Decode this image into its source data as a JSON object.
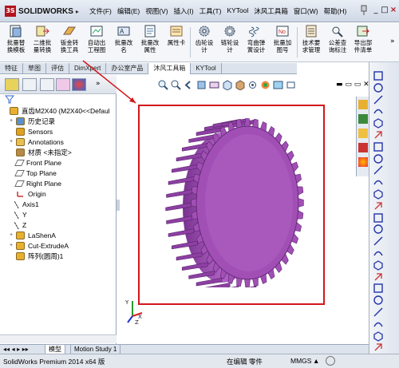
{
  "app": {
    "brand": "SOLIDWORKS",
    "logo_mark": "3S"
  },
  "menu": [
    "文件(F)",
    "编辑(E)",
    "视图(V)",
    "插入(I)",
    "工具(T)",
    "KYTool",
    "沐风工具箱",
    "窗口(W)",
    "帮助(H)"
  ],
  "window_controls": {
    "minimize": "_",
    "restore": "□",
    "close": "×"
  },
  "command_buttons": [
    {
      "label1": "批量替",
      "label2": "换模板"
    },
    {
      "label1": "二维批",
      "label2": "量转换"
    },
    {
      "label1": "钣金转",
      "label2": "换工具"
    },
    {
      "label1": "自动出",
      "label2": "工程图"
    },
    {
      "label1": "批量改",
      "label2": "名"
    },
    {
      "label1": "批量改",
      "label2": "属性"
    },
    {
      "label1": "属性卡",
      "label2": ""
    },
    {
      "label1": "齿轮设",
      "label2": "计"
    },
    {
      "label1": "链轮设",
      "label2": "计"
    },
    {
      "label1": "弯曲弹",
      "label2": "簧设计"
    },
    {
      "label1": "批量加",
      "label2": "图号"
    },
    {
      "label1": "技术要",
      "label2": "求管理"
    },
    {
      "label1": "公差查",
      "label2": "询标注"
    },
    {
      "label1": "导出部",
      "label2": "件清单"
    }
  ],
  "tabs": [
    "特征",
    "草图",
    "评估",
    "DimXpert",
    "办公室产品",
    "沐风工具箱",
    "KYTool"
  ],
  "active_tab_index": 5,
  "tree": [
    {
      "label": "直齿M2X40  (M2X40<<Defaul",
      "icon": "part-icon",
      "toggle": "",
      "indent": 0
    },
    {
      "label": "历史记录",
      "icon": "history-icon",
      "toggle": "+",
      "indent": 1
    },
    {
      "label": "Sensors",
      "icon": "sensors-icon",
      "toggle": "",
      "indent": 1
    },
    {
      "label": "Annotations",
      "icon": "annotations-icon",
      "toggle": "+",
      "indent": 1
    },
    {
      "label": "材质 <未指定>",
      "icon": "material-icon",
      "toggle": "",
      "indent": 1
    },
    {
      "label": "Front Plane",
      "icon": "plane-icon",
      "toggle": "",
      "indent": 1
    },
    {
      "label": "Top Plane",
      "icon": "plane-icon",
      "toggle": "",
      "indent": 1
    },
    {
      "label": "Right Plane",
      "icon": "plane-icon",
      "toggle": "",
      "indent": 1
    },
    {
      "label": "Origin",
      "icon": "origin-icon",
      "toggle": "",
      "indent": 1
    },
    {
      "label": "Axis1",
      "icon": "axis-icon",
      "toggle": "",
      "indent": 1
    },
    {
      "label": "Y",
      "icon": "axis-icon",
      "toggle": "",
      "indent": 1
    },
    {
      "label": "Z",
      "icon": "axis-icon",
      "toggle": "",
      "indent": 1
    },
    {
      "label": "LaShenA",
      "icon": "extrude-icon",
      "toggle": "+",
      "indent": 1
    },
    {
      "label": "Cut-ExtrudeA",
      "icon": "cut-extrude-icon",
      "toggle": "+",
      "indent": 1
    },
    {
      "label": "阵列(圆周)1",
      "icon": "circular-pattern-icon",
      "toggle": "",
      "indent": 1
    }
  ],
  "bottom_tabs": [
    "模型",
    "Motion Study 1"
  ],
  "status": {
    "product": "SolidWorks Premium 2014 x64 版",
    "mode": "在编辑 零件",
    "units": "MMGS"
  },
  "colors": {
    "gear": "#a14fb5",
    "gear_dark": "#6f2d80",
    "highlight": "#d2161b",
    "accent": "#b3121d"
  }
}
